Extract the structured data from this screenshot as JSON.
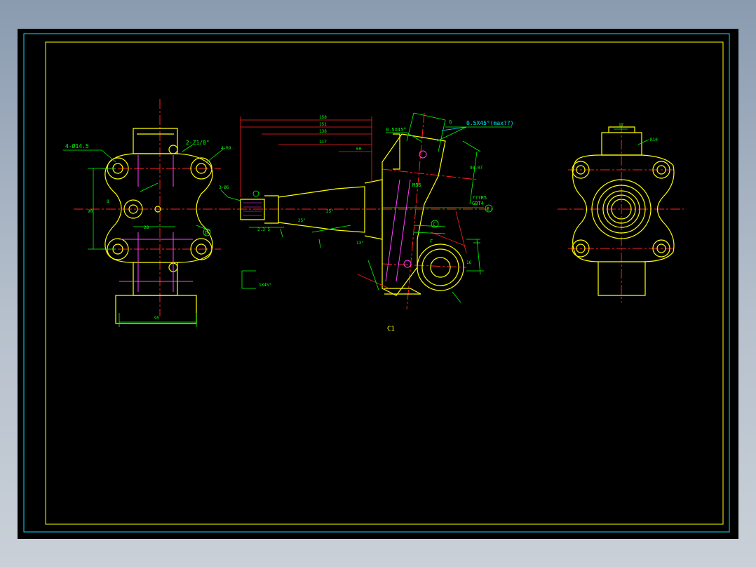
{
  "colors": {
    "background": "#000000",
    "frame_outer": "#00e5ff",
    "frame_inner": "#ffff00",
    "outline": "#ffff00",
    "centerline": "#ff2020",
    "dimension": "#00ff00",
    "hidden": "#ff40ff",
    "leader": "#00e5ff"
  },
  "view_left": {
    "hole_callout": "4-Ø14.5",
    "pipe_thread": "2-Z1/8\"",
    "radius_note": "4-R9",
    "dim_width_top": "95",
    "dim_width_bottom": "95",
    "dim_hole_center": "28",
    "dim_height": "90",
    "dim_side": "8",
    "section_marker": "D"
  },
  "view_center": {
    "dims_top": [
      "158",
      "151",
      "138",
      "117",
      "60"
    ],
    "chamfer_top": "0.5X45°",
    "chamfer_note": "0.5X45°(max??)",
    "thread_note": "3-Ø6",
    "angle_1": "25°",
    "angle_2": "25°",
    "angle_3": "13°",
    "dim_m56": "M56",
    "dim_small": "2.3 5",
    "code_gbt": "GBT4",
    "code_ab": "???R5",
    "marker_e": "E",
    "marker_c": "C",
    "marker_f": "F",
    "marker_g": "G",
    "dim_right": "98.07",
    "dim_16": "16",
    "dim_1x45": "1X45°"
  },
  "view_right": {
    "dim_top": "17",
    "dim_radius": "R10"
  },
  "caption": "C1"
}
